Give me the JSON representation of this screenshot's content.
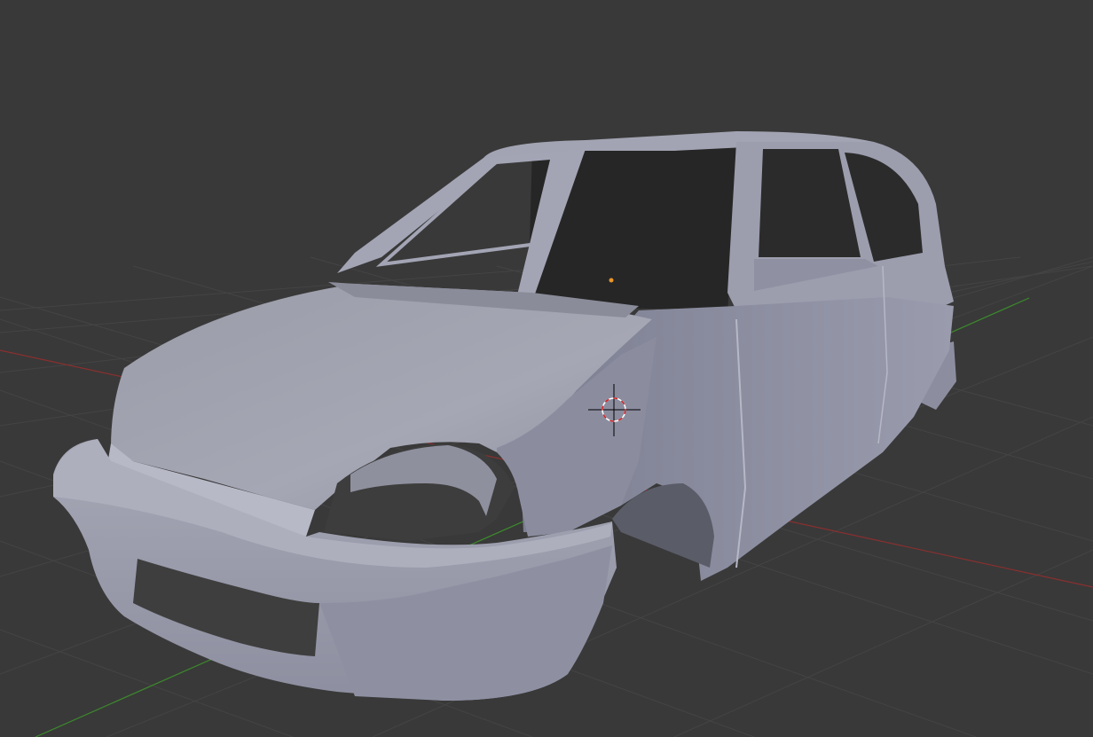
{
  "viewport": {
    "background_color": "#393939",
    "grid_line_color": "#444444",
    "x_axis_color": "#8a2f2f",
    "y_axis_color": "#3c8a2c"
  },
  "scene": {
    "object": "car-body-mesh",
    "object_color": "#9597a8",
    "object_shadow_color": "#6f7184",
    "object_highlight_color": "#b3b5c4",
    "interior_color": "#262626"
  },
  "cursor_3d": {
    "icon": "3d-cursor-icon",
    "ring_colors": [
      "#ffffff",
      "#d22222"
    ]
  },
  "origin": {
    "icon": "object-origin-icon",
    "color": "#e8962a"
  }
}
